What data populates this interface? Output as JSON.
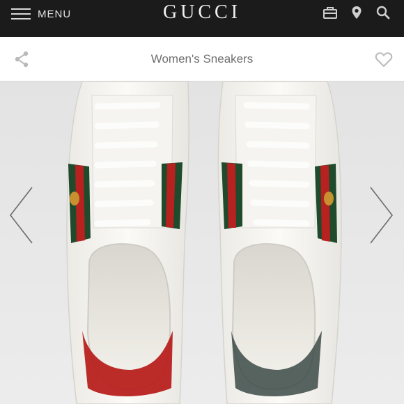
{
  "header": {
    "menu_label": "MENU",
    "brand": "GUCCI",
    "icons": [
      "shopping-bag-icon",
      "location-pin-icon",
      "search-icon"
    ]
  },
  "titlebar": {
    "title": "Women's Sneakers",
    "left_icon": "share-icon",
    "right_icon": "heart-icon"
  },
  "gallery": {
    "prev_icon": "chevron-left-icon",
    "next_icon": "chevron-right-icon"
  },
  "colors": {
    "header_bg": "#1b1b1b",
    "stripe_green": "#1f4a2c",
    "stripe_red": "#b7211f",
    "sneaker_white": "#f7f6f2"
  }
}
